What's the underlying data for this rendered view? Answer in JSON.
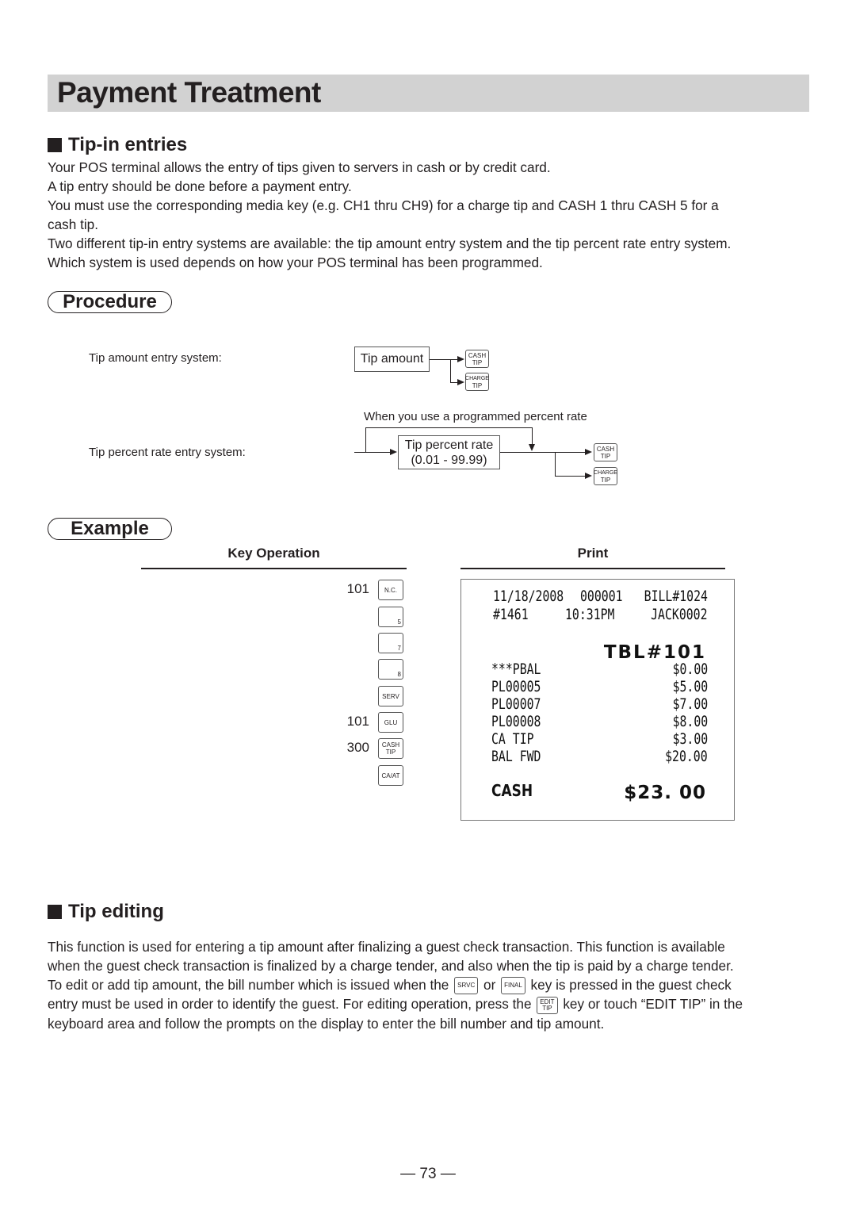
{
  "page": {
    "title": "Payment Treatment",
    "page_number": "73"
  },
  "tip_in": {
    "heading": "Tip-in entries",
    "paragraphs": [
      "Your POS terminal allows the entry of tips given to servers in cash or by credit card.",
      "A tip entry should be done before a payment entry.",
      "You must use the corresponding media key (e.g. CH1 thru CH9) for a charge tip and CASH 1 thru CASH 5 for a",
      "cash tip.",
      "Two different tip-in entry systems are available: the tip amount entry system and the tip percent rate entry system.",
      "Which system is used depends on how your POS terminal has been programmed."
    ]
  },
  "procedure": {
    "label": "Procedure",
    "amount_system_label": "Tip amount entry system:",
    "amount_box": "Tip amount",
    "percent_note": "When you use a programmed percent rate",
    "percent_system_label": "Tip percent rate entry system:",
    "percent_box_line1": "Tip percent rate",
    "percent_box_line2": "(0.01 - 99.99)",
    "keys": {
      "cash_tip": [
        "CASH",
        "TIP"
      ],
      "charge_tip": [
        "CHARGE",
        "TIP"
      ]
    }
  },
  "example": {
    "label": "Example",
    "key_operation_header": "Key Operation",
    "print_header": "Print",
    "key_ops": [
      {
        "num": "101",
        "key": [
          "N.C."
        ],
        "type": "func"
      },
      {
        "num": "",
        "key": [
          "5"
        ],
        "type": "num"
      },
      {
        "num": "",
        "key": [
          "7"
        ],
        "type": "num"
      },
      {
        "num": "",
        "key": [
          "8"
        ],
        "type": "num"
      },
      {
        "num": "",
        "key": [
          "SERV"
        ],
        "type": "func"
      },
      {
        "num": "101",
        "key": [
          "GLU"
        ],
        "type": "func"
      },
      {
        "num": "300",
        "key": [
          "CASH",
          "TIP"
        ],
        "type": "func"
      },
      {
        "num": "",
        "key": [
          "CA/AT"
        ],
        "type": "func"
      }
    ],
    "receipt": {
      "header1": {
        "date": "11/18/2008",
        "consec": "000001",
        "bill": "BILL#1024"
      },
      "header2": {
        "receipt_no": "#1461",
        "time": "10:31PM",
        "clerk": "JACK0002"
      },
      "table": "TBL#101",
      "lines": [
        {
          "label": "***PBAL",
          "amount": "$0.00"
        },
        {
          "label": "PL00005",
          "amount": "$5.00"
        },
        {
          "label": "PL00007",
          "amount": "$7.00"
        },
        {
          "label": "PL00008",
          "amount": "$8.00"
        },
        {
          "label": "CA TIP",
          "amount": "$3.00"
        },
        {
          "label": "BAL FWD",
          "amount": "$20.00"
        }
      ],
      "total_label": "CASH",
      "total_amount": "$23. 00"
    }
  },
  "tip_editing": {
    "heading": "Tip editing",
    "line1": "This function is used for entering a tip amount after finalizing a guest check transaction. This function is available",
    "line2": "when the guest check transaction is finalized by a charge tender, and also when the tip is paid by a charge tender.",
    "line3_a": "To edit or add tip amount, the bill number which is issued when the",
    "key_srvc": "SRVC",
    "line3_or": "or",
    "key_final": "FINAL",
    "line3_b": "key is pressed in the guest check",
    "line4_a": "entry must be used in order to identify the guest. For editing operation, press the",
    "key_edit_tip": [
      "EDIT",
      "TIP"
    ],
    "line4_b": "key or touch “EDIT TIP” in the",
    "line5": "keyboard area and follow the prompts on the display to enter the bill number and tip amount."
  }
}
